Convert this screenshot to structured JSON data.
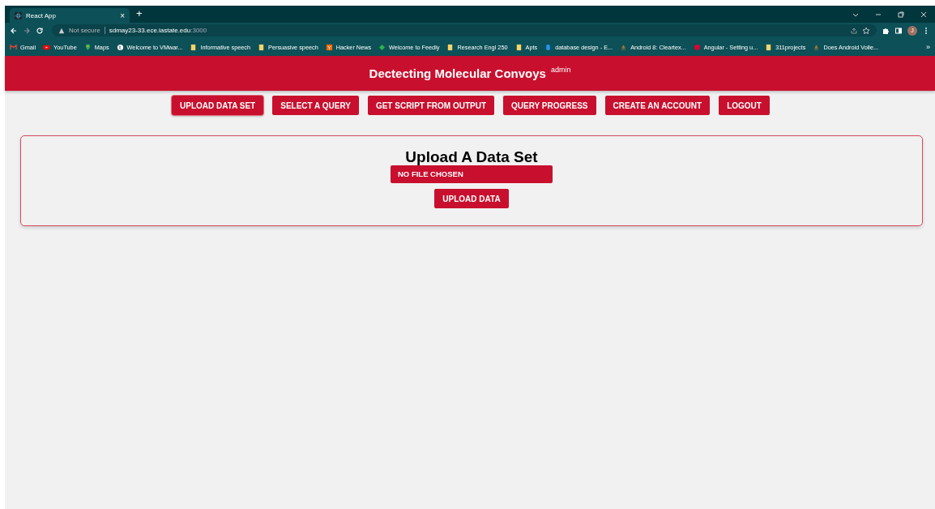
{
  "browser": {
    "tab_title": "React App",
    "new_tab": "+",
    "close_tab": "×",
    "security": "Not secure",
    "url_host": "sdmay23-33.ece.iastate.edu",
    "url_port": ":3000",
    "profile_initial": "J",
    "bookmarks": [
      {
        "label": "Gmail",
        "kind": "gmail"
      },
      {
        "label": "YouTube",
        "kind": "video"
      },
      {
        "label": "Maps",
        "kind": "pin"
      },
      {
        "label": "Welcome to VMwar...",
        "kind": "globe"
      },
      {
        "label": "Informative speech",
        "kind": "note"
      },
      {
        "label": "Persuasive speech",
        "kind": "note"
      },
      {
        "label": "Hacker News",
        "kind": "letter"
      },
      {
        "label": "Welcome to Feedly",
        "kind": "diamond"
      },
      {
        "label": "Research Engl 250",
        "kind": "note"
      },
      {
        "label": "Apts",
        "kind": "note"
      },
      {
        "label": "database design - E...",
        "kind": "database"
      },
      {
        "label": "Android 8: Cleartex...",
        "kind": "stamp"
      },
      {
        "label": "Angular - Setting u...",
        "kind": "shield"
      },
      {
        "label": "311projects",
        "kind": "note"
      },
      {
        "label": "Does Android Volle...",
        "kind": "stamp"
      }
    ],
    "more_bookmarks": "»"
  },
  "header": {
    "title": "Dectecting Molecular Convoys",
    "user": "admin"
  },
  "nav": [
    {
      "label": "UPLOAD DATA SET",
      "selected": true
    },
    {
      "label": "SELECT A QUERY",
      "selected": false
    },
    {
      "label": "GET SCRIPT FROM OUTPUT",
      "selected": false
    },
    {
      "label": "QUERY PROGRESS",
      "selected": false
    },
    {
      "label": "CREATE AN ACCOUNT",
      "selected": false
    },
    {
      "label": "LOGOUT",
      "selected": false
    }
  ],
  "upload": {
    "title": "Upload A Data Set",
    "file_status": "NO FILE CHOSEN",
    "button": "UPLOAD DATA"
  }
}
